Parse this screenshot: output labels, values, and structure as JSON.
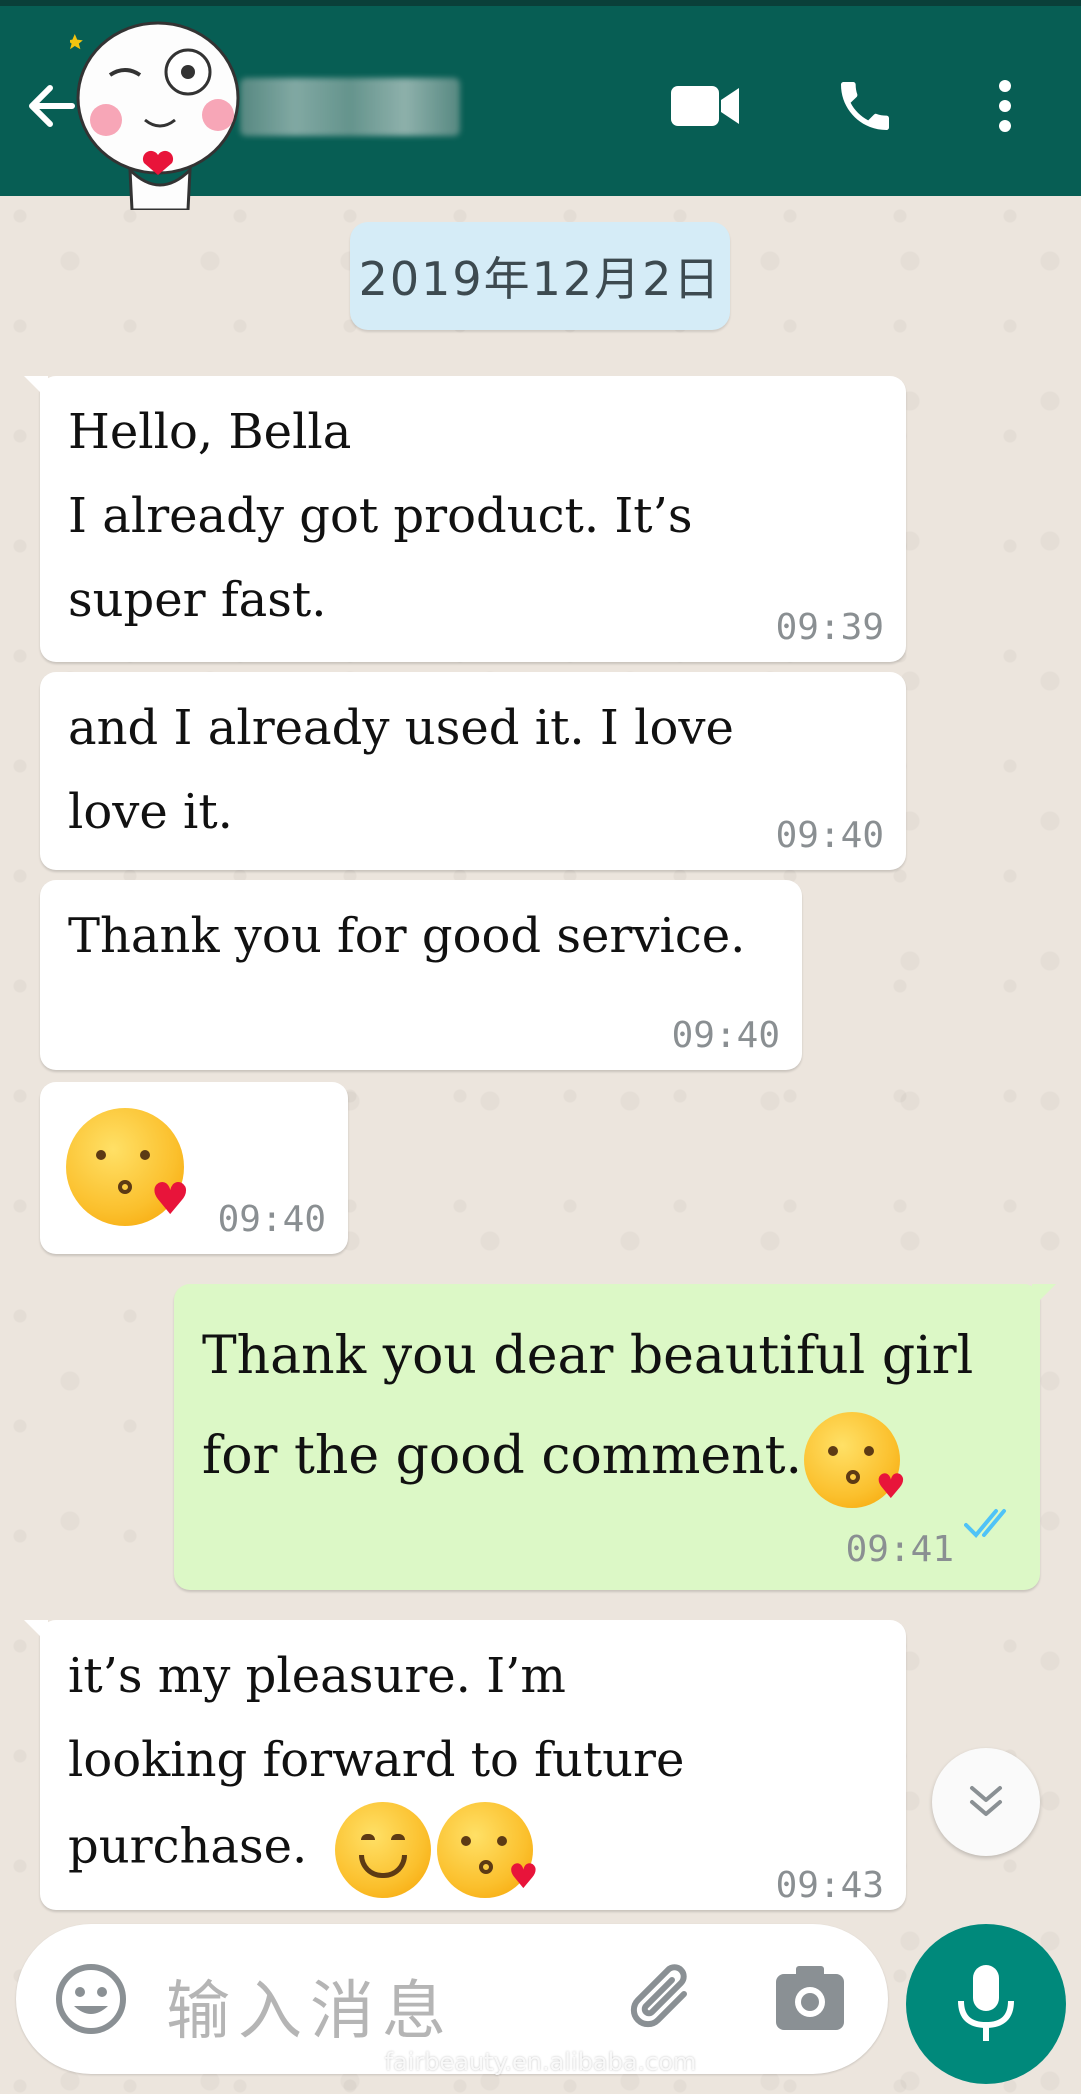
{
  "header": {
    "back_icon": "arrow-left-icon",
    "avatar": "cartoon-sticker-avatar",
    "contact_name_blurred": true,
    "video_icon": "video-camera-icon",
    "call_icon": "phone-icon",
    "menu_icon": "more-vertical-icon",
    "color": "#075e54"
  },
  "date_chip": "2019年12月2日",
  "messages": [
    {
      "direction": "in",
      "lines": [
        "Hello, Bella",
        "I already got product. It’s",
        "super fast."
      ],
      "time": "09:39"
    },
    {
      "direction": "in",
      "lines": [
        "and I already used it. I love",
        "love it."
      ],
      "time": "09:40"
    },
    {
      "direction": "in",
      "lines": [
        "Thank you for good service."
      ],
      "time": "09:40"
    },
    {
      "direction": "in",
      "emoji": "kissing-face-with-heart-icon",
      "time": "09:40"
    },
    {
      "direction": "out",
      "lines": [
        "Thank you dear beautiful girl",
        "for the good comment."
      ],
      "emoji": "kissing-face-with-heart-icon",
      "time": "09:41",
      "status": "read"
    },
    {
      "direction": "in",
      "lines": [
        "it’s my pleasure. I’m",
        "looking forward to future",
        "purchase."
      ],
      "emojis": [
        "smiling-face-icon",
        "kissing-face-with-heart-icon"
      ],
      "time": "09:43"
    }
  ],
  "input": {
    "placeholder": "输入消息",
    "emoji_icon": "emoji-icon",
    "attach_icon": "paperclip-icon",
    "camera_icon": "camera-icon",
    "mic_icon": "microphone-icon"
  },
  "scroll_down_icon": "double-chevron-down-icon",
  "watermark": "fairbeauty.en.alibaba.com",
  "colors": {
    "incoming": "#ffffff",
    "outgoing": "#dcf8c6",
    "read_ticks": "#4fc3f7",
    "mic_button": "#00897b"
  }
}
